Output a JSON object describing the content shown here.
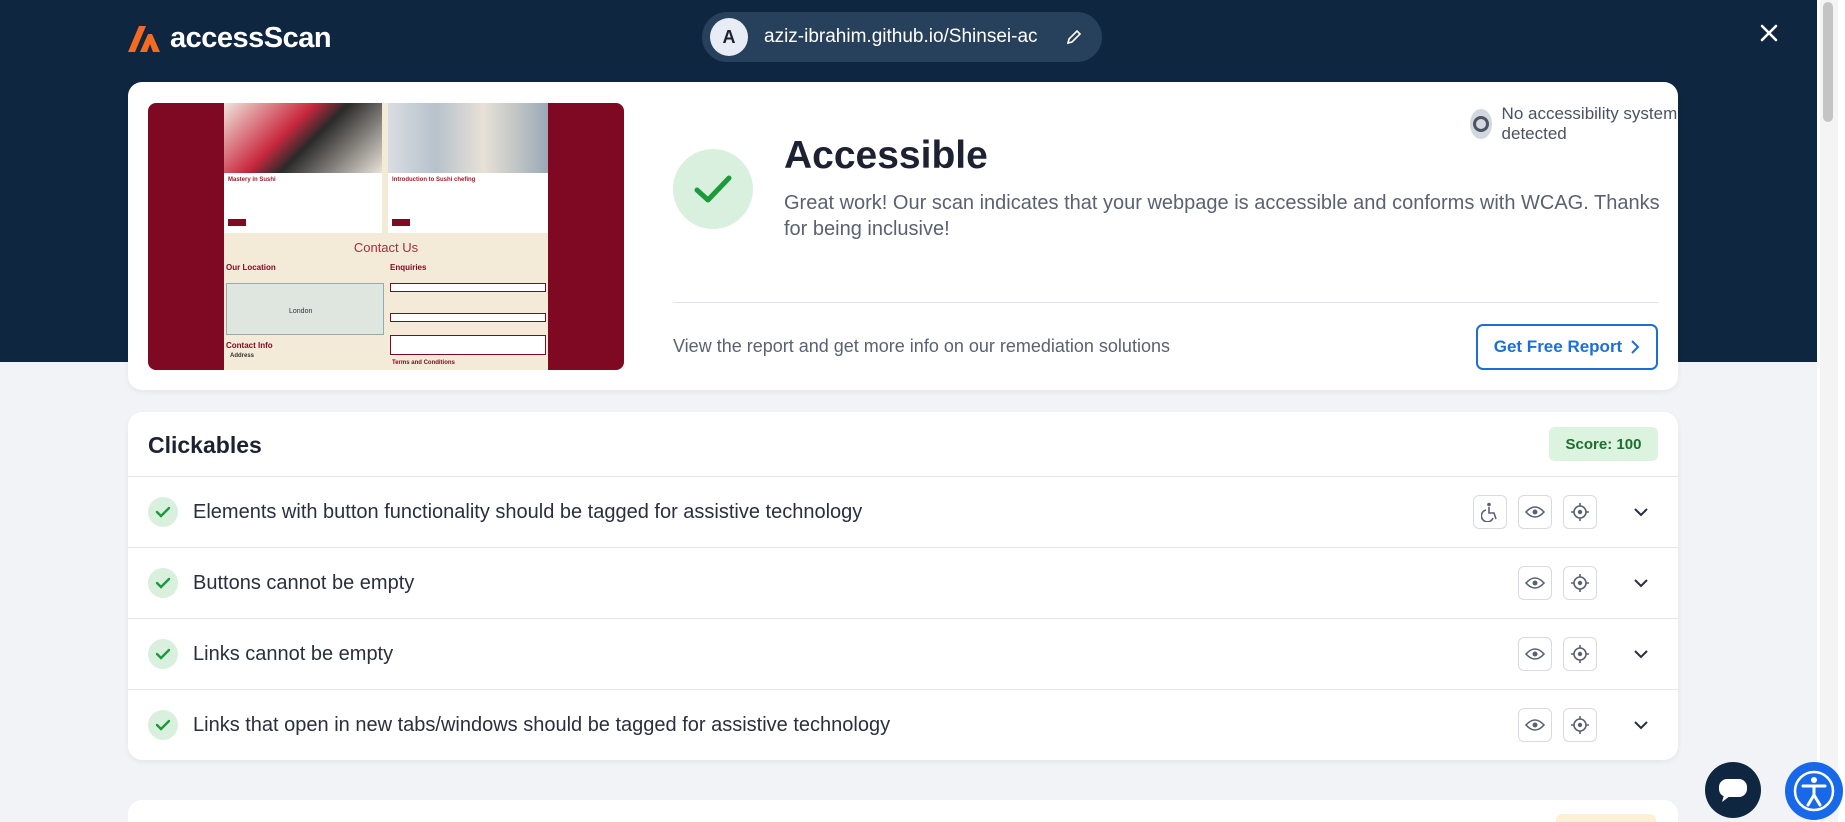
{
  "app": {
    "name": "accessScan"
  },
  "header": {
    "avatar_letter": "A",
    "url": "aziz-ibrahim.github.io/Shinsei-ac"
  },
  "result": {
    "status_badge": "No accessibility system detected",
    "title": "Accessible",
    "description": "Great work! Our scan indicates that your webpage is accessible and conforms with WCAG. Thanks for being inclusive!",
    "report_text": "View the report and get more info on our remediation solutions",
    "report_button": "Get Free Report"
  },
  "thumbnail": {
    "card1_title": "Mastery in Sushi",
    "card2_title": "Introduction to Sushi chefing",
    "heading": "Contact Us",
    "location_label": "Our Location",
    "enquiries_label": "Enquiries",
    "contact_label": "Contact Info",
    "address_label": "Address",
    "terms_label": "Terms and Conditions",
    "map_label": "London"
  },
  "section": {
    "title": "Clickables",
    "score": "Score: 100",
    "rules": [
      {
        "label": "Elements with button functionality should be tagged for assistive technology",
        "icons": [
          "wheelchair-icon",
          "eye-icon",
          "target-icon"
        ]
      },
      {
        "label": "Buttons cannot be empty",
        "icons": [
          "eye-icon",
          "target-icon"
        ]
      },
      {
        "label": "Links cannot be empty",
        "icons": [
          "eye-icon",
          "target-icon"
        ]
      },
      {
        "label": "Links that open in new tabs/windows should be tagged for assistive technology",
        "icons": [
          "eye-icon",
          "target-icon"
        ]
      }
    ]
  },
  "colors": {
    "header_bg": "#0f2640",
    "accent_blue": "#1c6fd6",
    "success_green": "#1d9a3a",
    "logo_orange": "#f26b21"
  }
}
